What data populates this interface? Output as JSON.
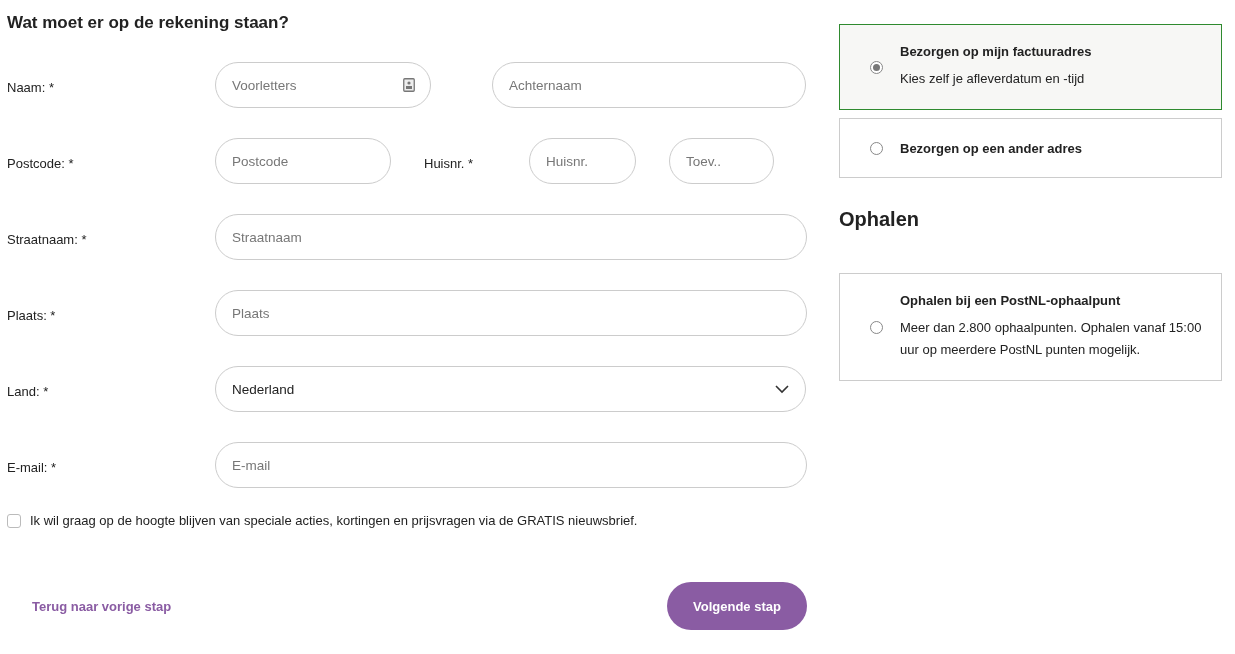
{
  "title": "Wat moet er op de rekening staan?",
  "rows": [
    {
      "kind": "pair",
      "label": "Naam: *",
      "inputs": [
        {
          "placeholder": "Voorletters",
          "contact_icon": true
        },
        {
          "placeholder": "Achternaam"
        }
      ]
    },
    {
      "kind": "address",
      "label": "Postcode: *",
      "sub_label": "Huisnr. *",
      "inputs": [
        {
          "placeholder": "Postcode"
        },
        {
          "placeholder": "Huisnr."
        },
        {
          "placeholder": "Toev.."
        }
      ]
    },
    {
      "kind": "single",
      "label": "Straatnaam: *",
      "inputs": [
        {
          "placeholder": "Straatnaam"
        }
      ]
    },
    {
      "kind": "single",
      "label": "Plaats: *",
      "inputs": [
        {
          "placeholder": "Plaats"
        }
      ]
    },
    {
      "kind": "select",
      "label": "Land: *",
      "inputs": [
        {
          "value": "Nederland"
        }
      ]
    },
    {
      "kind": "single",
      "label": "E-mail: *",
      "inputs": [
        {
          "placeholder": "E-mail"
        }
      ]
    }
  ],
  "newsletter": {
    "label": "Ik wil graag op de hoogte blijven van speciale acties, kortingen en prijsvragen via de GRATIS nieuwsbrief.",
    "checked": false
  },
  "back_link": "Terug naar vorige stap",
  "next_button": "Volgende stap",
  "delivery_options": [
    {
      "title": "Bezorgen op mijn factuuradres",
      "subtitle": "Kies zelf je afleverdatum en -tijd",
      "selected": true
    },
    {
      "title": "Bezorgen op een ander adres",
      "selected": false
    }
  ],
  "pickup_heading": "Ophalen",
  "pickup_options": [
    {
      "title": "Ophalen bij een PostNL-ophaalpunt",
      "subtitle": "Meer dan 2.800 ophaalpunten. Ophalen vanaf 15:00 uur op meerdere PostNL punten mogelijk.",
      "selected": false
    }
  ]
}
